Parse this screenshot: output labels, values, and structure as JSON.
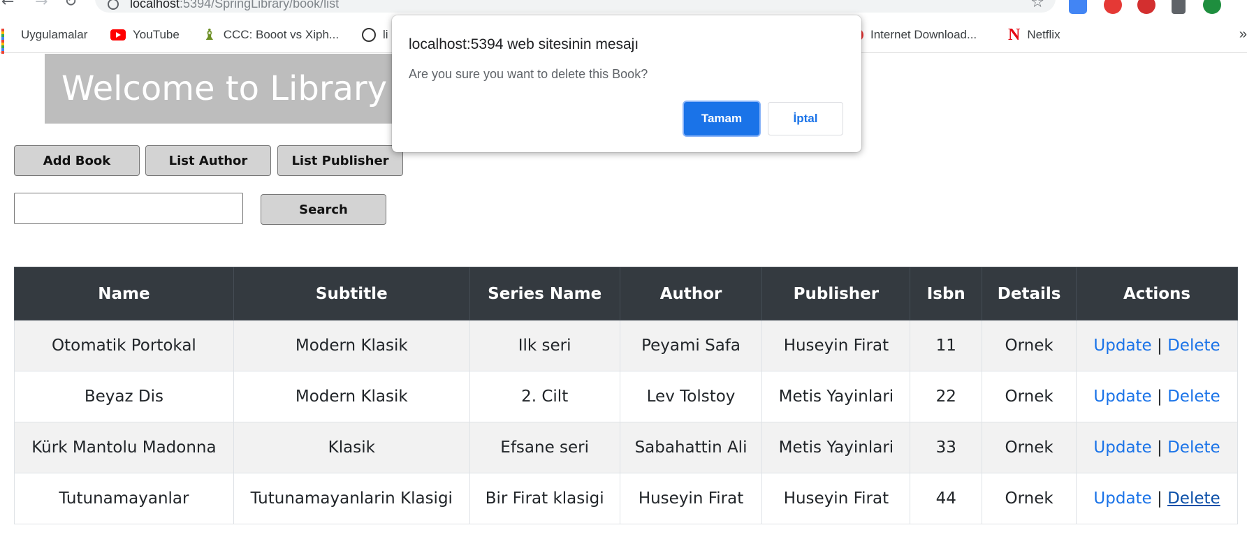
{
  "browser": {
    "url_host": "localhost",
    "url_rest": ":5394/SpringLibrary/book/list",
    "bookmarks": [
      {
        "label": "Uygulamalar",
        "icon": "apps-grid-icon"
      },
      {
        "label": "YouTube",
        "icon": "youtube-icon"
      },
      {
        "label": "CCC: Booot vs Xiph...",
        "icon": "chess-icon"
      },
      {
        "label": "li",
        "icon": "loop-icon"
      },
      {
        "label": "Internet Download...",
        "icon": "idm-icon"
      },
      {
        "label": "Netflix",
        "icon": "netflix-icon"
      }
    ],
    "more_glyph": "»",
    "colors": {
      "ext_blue": "#4285f4",
      "ext_red": "#e53935",
      "ext_green": "#1e8e3e"
    }
  },
  "page": {
    "welcome_title": "Welcome to Library",
    "buttons": {
      "add_book": "Add Book",
      "list_author": "List Author",
      "list_publisher": "List Publisher",
      "search": "Search"
    },
    "search_value": ""
  },
  "table": {
    "headers": [
      "Name",
      "Subtitle",
      "Series Name",
      "Author",
      "Publisher",
      "Isbn",
      "Details",
      "Actions"
    ],
    "rows": [
      {
        "name": "Otomatik Portokal",
        "subtitle": "Modern Klasik",
        "series": "Ilk seri",
        "author": "Peyami Safa",
        "publisher": "Huseyin Firat",
        "isbn": "11",
        "details": "Ornek"
      },
      {
        "name": "Beyaz Dis",
        "subtitle": "Modern Klasik",
        "series": "2. Cilt",
        "author": "Lev Tolstoy",
        "publisher": "Metis Yayinlari",
        "isbn": "22",
        "details": "Ornek"
      },
      {
        "name": "Kürk Mantolu Madonna",
        "subtitle": "Klasik",
        "series": "Efsane seri",
        "author": "Sabahattin Ali",
        "publisher": "Metis Yayinlari",
        "isbn": "33",
        "details": "Ornek"
      },
      {
        "name": "Tutunamayanlar",
        "subtitle": "Tutunamayanlarin Klasigi",
        "series": "Bir Firat klasigi",
        "author": "Huseyin Firat",
        "publisher": "Huseyin Firat",
        "isbn": "44",
        "details": "Ornek"
      }
    ],
    "action_update": "Update",
    "action_sep": "|",
    "action_delete": "Delete"
  },
  "dialog": {
    "title": "localhost:5394 web sitesinin mesajı",
    "message": "Are you sure you want to delete this Book?",
    "ok_label": "Tamam",
    "cancel_label": "İptal"
  }
}
